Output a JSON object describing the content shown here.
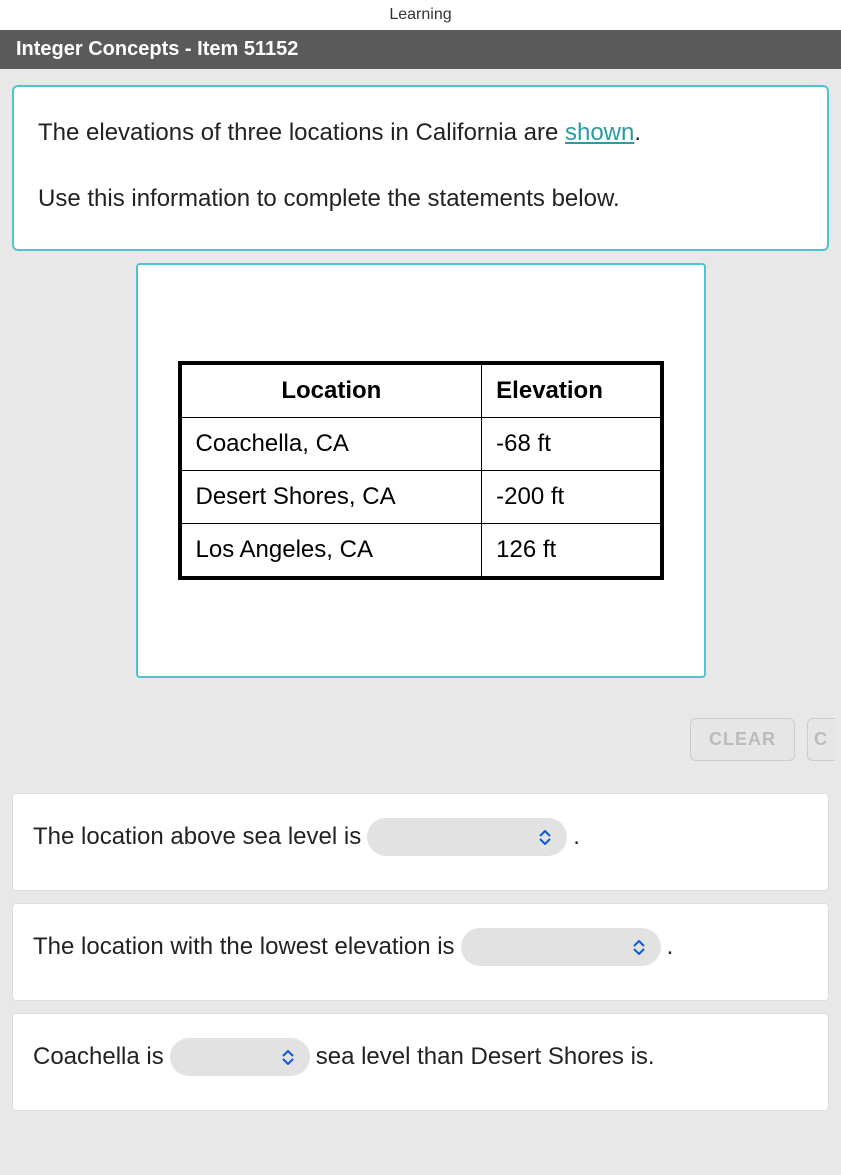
{
  "header": {
    "brand": "Learning"
  },
  "titlebar": {
    "text": "Integer Concepts - Item 51152"
  },
  "question": {
    "line1_prefix": "The elevations of three locations in California are ",
    "line1_link": "shown",
    "line1_suffix": ".",
    "line2": "Use this information to complete the statements below."
  },
  "table": {
    "headers": {
      "location": "Location",
      "elevation": "Elevation"
    },
    "rows": [
      {
        "location": "Coachella, CA",
        "elevation": "-68 ft"
      },
      {
        "location": "Desert Shores, CA",
        "elevation": "-200 ft"
      },
      {
        "location": "Los Angeles, CA",
        "elevation": "126 ft"
      }
    ]
  },
  "buttons": {
    "clear": "CLEAR",
    "partial": "C"
  },
  "statements": {
    "s1_prefix": "The location above sea level is",
    "s1_suffix": ".",
    "s2_prefix": "The location with the lowest elevation is",
    "s2_suffix": ".",
    "s3_prefix": "Coachella is",
    "s3_suffix": "sea level than Desert Shores is."
  }
}
